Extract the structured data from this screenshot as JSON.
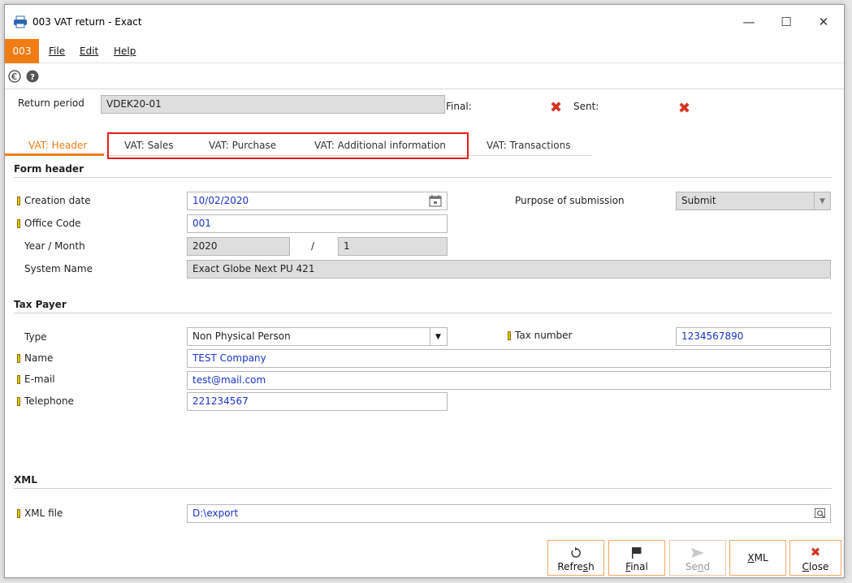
{
  "window": {
    "title": "003 VAT return - Exact",
    "minimize": "—",
    "maximize": "☐",
    "close": "✕"
  },
  "menubar": {
    "company": "003",
    "file": "File",
    "edit": "Edit",
    "help": "Help"
  },
  "toolbar": {
    "currency_icon": "euro-circle-icon",
    "help_icon": "help-circle-icon"
  },
  "header": {
    "return_period_label": "Return period",
    "return_period_value": "VDEK20-01",
    "final_label": "Final:",
    "sent_label": "Sent:",
    "status_mark": "✖"
  },
  "tabs": [
    {
      "label": "VAT: Header"
    },
    {
      "label": "VAT: Sales"
    },
    {
      "label": "VAT: Purchase"
    },
    {
      "label": "VAT: Additional information"
    },
    {
      "label": "VAT: Transactions"
    }
  ],
  "form_header": {
    "title": "Form header",
    "creation_date_label": "Creation date",
    "creation_date_value": "10/02/2020",
    "purpose_label": "Purpose of submission",
    "purpose_value": "Submit",
    "office_code_label": "Office Code",
    "office_code_value": "001",
    "year_month_label": "Year / Month",
    "year_value": "2020",
    "slash": "/",
    "month_value": "1",
    "system_name_label": "System Name",
    "system_name_value": "Exact Globe Next PU 421"
  },
  "tax_payer": {
    "title": "Tax Payer",
    "type_label": "Type",
    "type_value": "Non Physical Person",
    "tax_number_label": "Tax number",
    "tax_number_value": "1234567890",
    "name_label": "Name",
    "name_value": "TEST Company",
    "email_label": "E-mail",
    "email_value": "test@mail.com",
    "telephone_label": "Telephone",
    "telephone_value": "221234567"
  },
  "xml": {
    "title": "XML",
    "file_label": "XML file",
    "file_value": "D:\\export"
  },
  "buttons": {
    "refresh": {
      "pre": "Refre",
      "u": "s",
      "post": "h"
    },
    "final": {
      "pre": "",
      "u": "F",
      "post": "inal"
    },
    "send": {
      "pre": "Se",
      "u": "n",
      "post": "d"
    },
    "xml": {
      "pre": "",
      "u": "X",
      "post": "ML"
    },
    "close": {
      "pre": "",
      "u": "C",
      "post": "lose"
    }
  },
  "colors": {
    "accent": "#f07c14",
    "highlight_box": "#e0201c",
    "value_blue": "#1b34c7"
  }
}
